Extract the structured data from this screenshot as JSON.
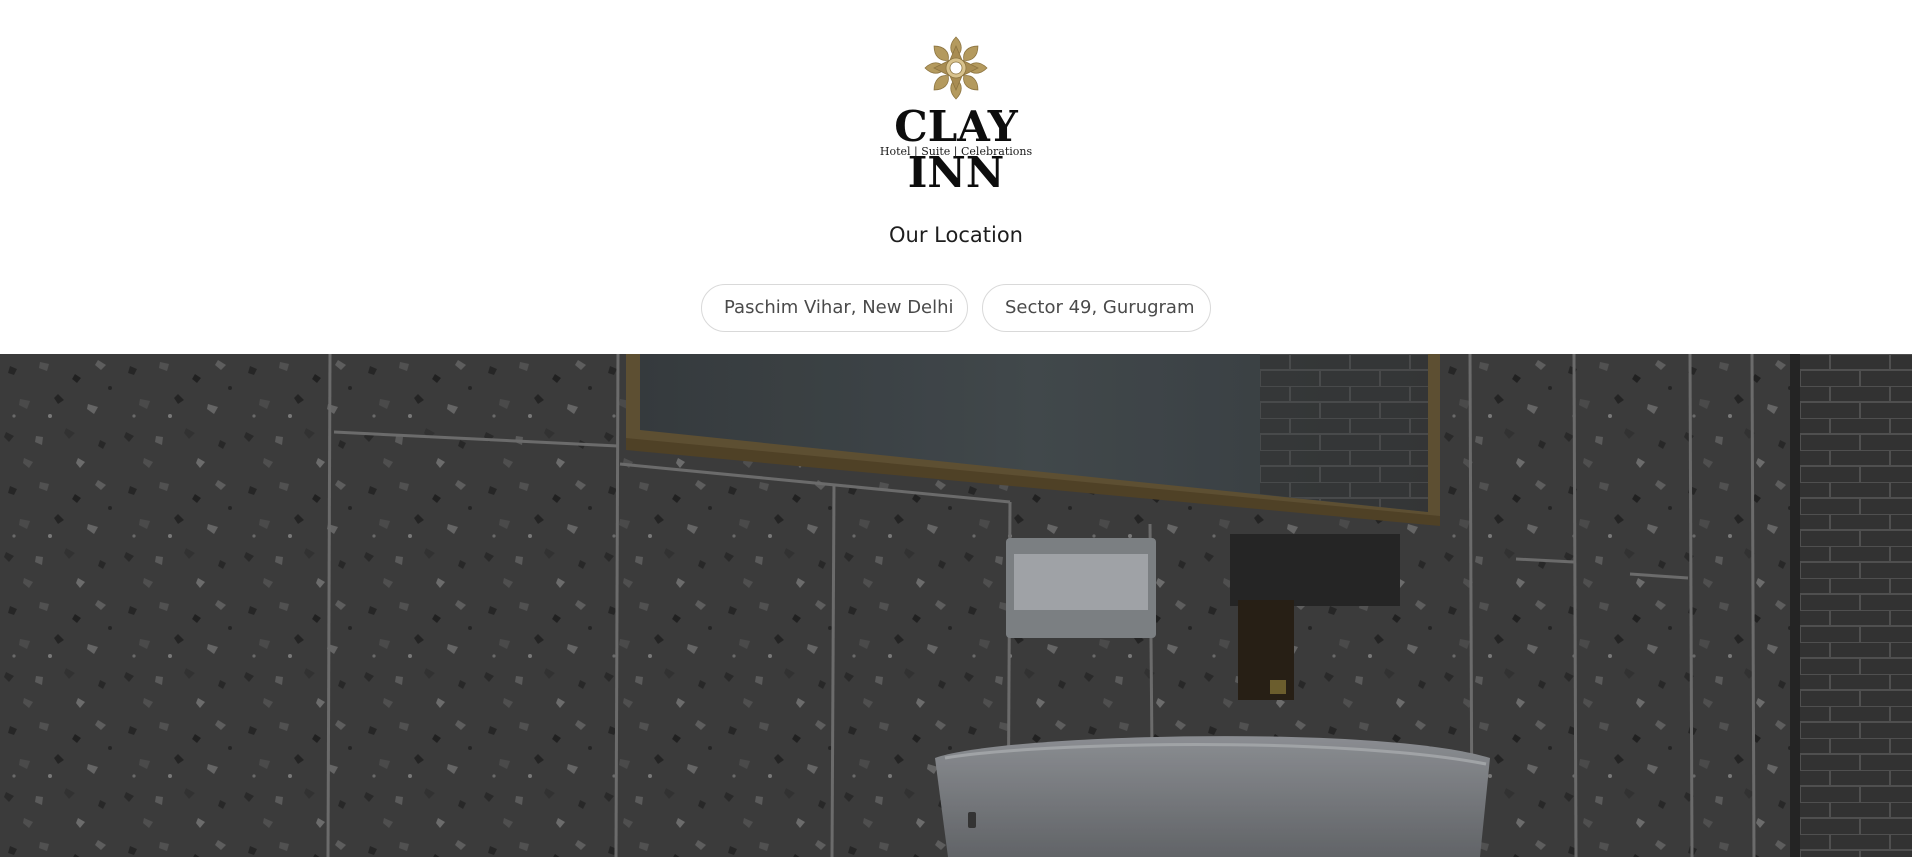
{
  "brand": {
    "name": "CLAY INN",
    "tagline": "Hotel | Suite | Celebrations",
    "logo_icon": "ornamental-star-icon",
    "accent": "#b49a5e"
  },
  "locations_section": {
    "title": "Our Location",
    "items": [
      {
        "label": "Paschim Vihar, New Delhi"
      },
      {
        "label": "Sector 49, Gurugram"
      }
    ]
  },
  "hero": {
    "image": "bathroom-washbasin-photo"
  },
  "colors": {
    "text": "#1e1e1e",
    "pill_border": "#d9d9d9",
    "pill_text": "#4a4a4a",
    "hero_overlay": "#3b3b3b"
  }
}
